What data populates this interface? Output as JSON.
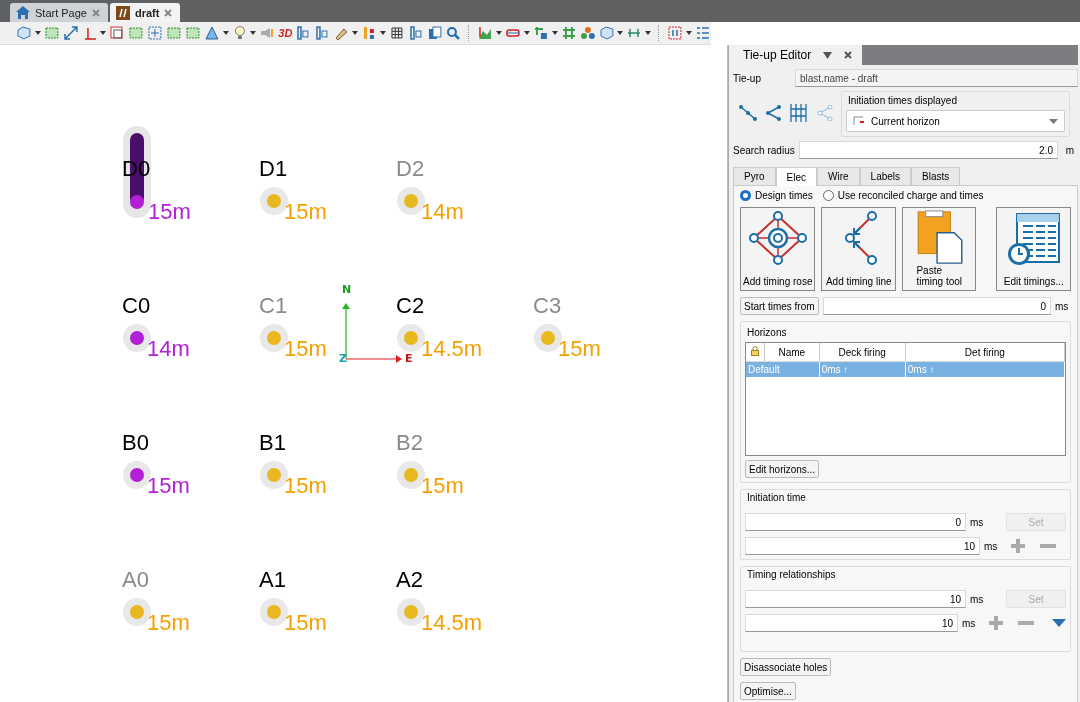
{
  "tabs": [
    {
      "label": "Start Page",
      "selected": false,
      "kind": "home"
    },
    {
      "label": "draft",
      "selected": true,
      "kind": "doc"
    }
  ],
  "toolbar": {
    "label_3d": "3D"
  },
  "canvas": {
    "axes": {
      "north": "N",
      "east": "E",
      "up": "Z"
    },
    "rows": [
      {
        "holes": [
          {
            "label": "D0",
            "dimmed": false,
            "kind": "column",
            "color": "#b21fd6",
            "depth": "15m"
          },
          {
            "label": "D1",
            "dimmed": false,
            "kind": "dot",
            "color": "#e8b820",
            "depth": "15m"
          },
          {
            "label": "D2",
            "dimmed": true,
            "kind": "dot",
            "color": "#e8b820",
            "depth": "14m"
          }
        ]
      },
      {
        "holes": [
          {
            "label": "C0",
            "dimmed": false,
            "kind": "dot",
            "color": "#b21fd6",
            "depth": "14m"
          },
          {
            "label": "C1",
            "dimmed": true,
            "kind": "dot",
            "color": "#e8b820",
            "depth": "15m"
          },
          {
            "label": "C2",
            "dimmed": false,
            "kind": "dot",
            "color": "#e8b820",
            "depth": "14.5m"
          },
          {
            "label": "C3",
            "dimmed": true,
            "kind": "dot",
            "color": "#e8b820",
            "depth": "15m"
          }
        ]
      },
      {
        "holes": [
          {
            "label": "B0",
            "dimmed": false,
            "kind": "dot",
            "color": "#b21fd6",
            "depth": "15m"
          },
          {
            "label": "B1",
            "dimmed": false,
            "kind": "dot",
            "color": "#e8b820",
            "depth": "15m"
          },
          {
            "label": "B2",
            "dimmed": true,
            "kind": "dot",
            "color": "#e8b820",
            "depth": "15m"
          }
        ]
      },
      {
        "holes": [
          {
            "label": "A0",
            "dimmed": true,
            "kind": "dot",
            "color": "#e8b820",
            "depth": "15m"
          },
          {
            "label": "A1",
            "dimmed": false,
            "kind": "dot",
            "color": "#e8b820",
            "depth": "15m"
          },
          {
            "label": "A2",
            "dimmed": false,
            "kind": "dot",
            "color": "#e8b820",
            "depth": "14.5m"
          }
        ]
      }
    ]
  },
  "panel": {
    "title": "Tie-up Editor",
    "tieup_label": "Tie-up",
    "tieup_value": "blast.name - draft",
    "initiation_group": "Initiation times displayed",
    "initiation_value": "Current horizon",
    "search_label": "Search radius",
    "search_value": "2.0",
    "search_unit": "m",
    "tabs": [
      {
        "label": "Pyro",
        "selected": false
      },
      {
        "label": "Elec",
        "selected": true
      },
      {
        "label": "Wire",
        "selected": false
      },
      {
        "label": "Labels",
        "selected": false
      },
      {
        "label": "Blasts",
        "selected": false
      }
    ],
    "radios": [
      {
        "label": "Design times",
        "selected": true
      },
      {
        "label": "Use reconciled charge and times",
        "selected": false
      }
    ],
    "big_buttons": [
      {
        "kind": "rose",
        "label": "Add timing rose"
      },
      {
        "kind": "line",
        "label": "Add timing line"
      },
      {
        "kind": "paste",
        "label": "Paste\ntiming tool"
      },
      {
        "kind": "edit",
        "label": "Edit timings..."
      }
    ],
    "start_button": "Start times from",
    "start_value": "0",
    "start_unit": "ms",
    "horizons": {
      "title": "Horizons",
      "columns": [
        "Name",
        "Deck firing",
        "Det firing"
      ],
      "rows": [
        {
          "cells": [
            "Default",
            "0ms ↑",
            "0ms ↑"
          ],
          "selected": true
        }
      ],
      "edit_button": "Edit horizons..."
    },
    "initiation_time": {
      "title": "Initiation time",
      "value": "0",
      "unit": "ms",
      "set": "Set",
      "set_disabled": true,
      "step": "10",
      "step_unit": "ms"
    },
    "timing": {
      "title": "Timing relationships",
      "value": "10",
      "unit": "ms",
      "set": "Set",
      "set_disabled": true,
      "step": "10",
      "step_unit": "ms"
    },
    "buttons": [
      "Disassociate holes",
      "Optimise..."
    ]
  }
}
